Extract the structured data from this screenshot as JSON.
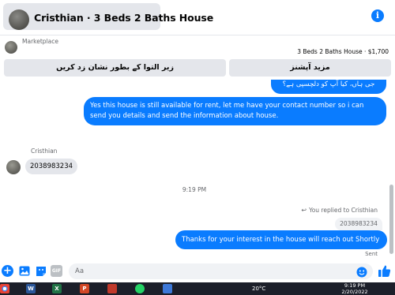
{
  "header": {
    "title": "Cristhian · 3 Beds 2 Baths House"
  },
  "marketplace": {
    "label": "Marketplace",
    "listing": "3 Beds 2 Baths House · $1,700",
    "mark_pending_label": "زیر التوا کے بطور نشان زد کریں",
    "more_options_label": "مزید آپشنز"
  },
  "messages": {
    "top_partial": "جی ہاں، کیا آپ کو دلچسپی ہے؟",
    "available_msg": "Yes this house is still available for rent, let me have your contact number so i can send you details and send the information about house.",
    "sender_name": "Cristhian",
    "phone_msg": "2038983234",
    "time_label": "9:19 PM",
    "replied_label": "You replied to Cristhian",
    "quoted_text": "2038983234",
    "thanks_msg": "Thanks for your interest in the house will reach out Shortly",
    "status": "Sent"
  },
  "composer": {
    "placeholder": "Aa"
  },
  "taskbar": {
    "temperature": "20°C",
    "time": "9:19 PM",
    "date": "2/20/2022",
    "icons": [
      "chrome-icon",
      "word-icon",
      "excel-icon",
      "powerpoint-icon",
      "app-icon",
      "whatsapp-icon",
      "store-icon"
    ]
  },
  "colors": {
    "accent": "#0a7cff",
    "bubble_in": "#e4e6eb",
    "muted_text": "#65676b",
    "taskbar": "#1c1f2a"
  }
}
